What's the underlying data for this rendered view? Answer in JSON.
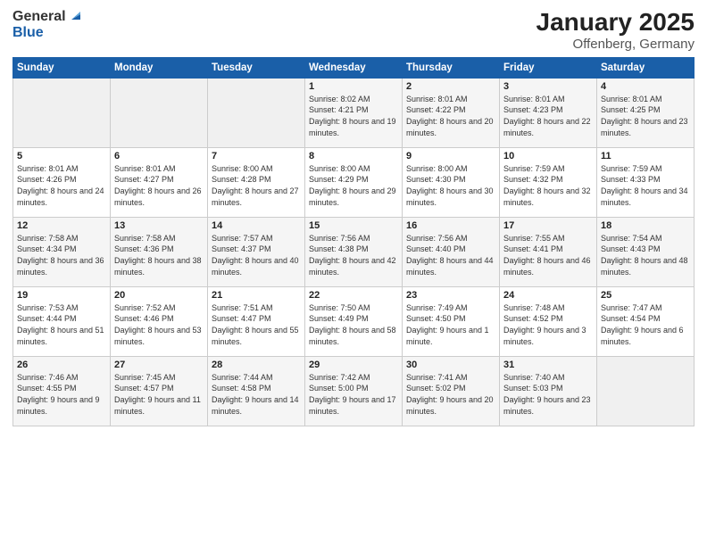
{
  "logo": {
    "general": "General",
    "blue": "Blue"
  },
  "title": "January 2025",
  "subtitle": "Offenberg, Germany",
  "weekdays": [
    "Sunday",
    "Monday",
    "Tuesday",
    "Wednesday",
    "Thursday",
    "Friday",
    "Saturday"
  ],
  "weeks": [
    [
      {
        "day": "",
        "sunrise": "",
        "sunset": "",
        "daylight": ""
      },
      {
        "day": "",
        "sunrise": "",
        "sunset": "",
        "daylight": ""
      },
      {
        "day": "",
        "sunrise": "",
        "sunset": "",
        "daylight": ""
      },
      {
        "day": "1",
        "sunrise": "Sunrise: 8:02 AM",
        "sunset": "Sunset: 4:21 PM",
        "daylight": "Daylight: 8 hours and 19 minutes."
      },
      {
        "day": "2",
        "sunrise": "Sunrise: 8:01 AM",
        "sunset": "Sunset: 4:22 PM",
        "daylight": "Daylight: 8 hours and 20 minutes."
      },
      {
        "day": "3",
        "sunrise": "Sunrise: 8:01 AM",
        "sunset": "Sunset: 4:23 PM",
        "daylight": "Daylight: 8 hours and 22 minutes."
      },
      {
        "day": "4",
        "sunrise": "Sunrise: 8:01 AM",
        "sunset": "Sunset: 4:25 PM",
        "daylight": "Daylight: 8 hours and 23 minutes."
      }
    ],
    [
      {
        "day": "5",
        "sunrise": "Sunrise: 8:01 AM",
        "sunset": "Sunset: 4:26 PM",
        "daylight": "Daylight: 8 hours and 24 minutes."
      },
      {
        "day": "6",
        "sunrise": "Sunrise: 8:01 AM",
        "sunset": "Sunset: 4:27 PM",
        "daylight": "Daylight: 8 hours and 26 minutes."
      },
      {
        "day": "7",
        "sunrise": "Sunrise: 8:00 AM",
        "sunset": "Sunset: 4:28 PM",
        "daylight": "Daylight: 8 hours and 27 minutes."
      },
      {
        "day": "8",
        "sunrise": "Sunrise: 8:00 AM",
        "sunset": "Sunset: 4:29 PM",
        "daylight": "Daylight: 8 hours and 29 minutes."
      },
      {
        "day": "9",
        "sunrise": "Sunrise: 8:00 AM",
        "sunset": "Sunset: 4:30 PM",
        "daylight": "Daylight: 8 hours and 30 minutes."
      },
      {
        "day": "10",
        "sunrise": "Sunrise: 7:59 AM",
        "sunset": "Sunset: 4:32 PM",
        "daylight": "Daylight: 8 hours and 32 minutes."
      },
      {
        "day": "11",
        "sunrise": "Sunrise: 7:59 AM",
        "sunset": "Sunset: 4:33 PM",
        "daylight": "Daylight: 8 hours and 34 minutes."
      }
    ],
    [
      {
        "day": "12",
        "sunrise": "Sunrise: 7:58 AM",
        "sunset": "Sunset: 4:34 PM",
        "daylight": "Daylight: 8 hours and 36 minutes."
      },
      {
        "day": "13",
        "sunrise": "Sunrise: 7:58 AM",
        "sunset": "Sunset: 4:36 PM",
        "daylight": "Daylight: 8 hours and 38 minutes."
      },
      {
        "day": "14",
        "sunrise": "Sunrise: 7:57 AM",
        "sunset": "Sunset: 4:37 PM",
        "daylight": "Daylight: 8 hours and 40 minutes."
      },
      {
        "day": "15",
        "sunrise": "Sunrise: 7:56 AM",
        "sunset": "Sunset: 4:38 PM",
        "daylight": "Daylight: 8 hours and 42 minutes."
      },
      {
        "day": "16",
        "sunrise": "Sunrise: 7:56 AM",
        "sunset": "Sunset: 4:40 PM",
        "daylight": "Daylight: 8 hours and 44 minutes."
      },
      {
        "day": "17",
        "sunrise": "Sunrise: 7:55 AM",
        "sunset": "Sunset: 4:41 PM",
        "daylight": "Daylight: 8 hours and 46 minutes."
      },
      {
        "day": "18",
        "sunrise": "Sunrise: 7:54 AM",
        "sunset": "Sunset: 4:43 PM",
        "daylight": "Daylight: 8 hours and 48 minutes."
      }
    ],
    [
      {
        "day": "19",
        "sunrise": "Sunrise: 7:53 AM",
        "sunset": "Sunset: 4:44 PM",
        "daylight": "Daylight: 8 hours and 51 minutes."
      },
      {
        "day": "20",
        "sunrise": "Sunrise: 7:52 AM",
        "sunset": "Sunset: 4:46 PM",
        "daylight": "Daylight: 8 hours and 53 minutes."
      },
      {
        "day": "21",
        "sunrise": "Sunrise: 7:51 AM",
        "sunset": "Sunset: 4:47 PM",
        "daylight": "Daylight: 8 hours and 55 minutes."
      },
      {
        "day": "22",
        "sunrise": "Sunrise: 7:50 AM",
        "sunset": "Sunset: 4:49 PM",
        "daylight": "Daylight: 8 hours and 58 minutes."
      },
      {
        "day": "23",
        "sunrise": "Sunrise: 7:49 AM",
        "sunset": "Sunset: 4:50 PM",
        "daylight": "Daylight: 9 hours and 1 minute."
      },
      {
        "day": "24",
        "sunrise": "Sunrise: 7:48 AM",
        "sunset": "Sunset: 4:52 PM",
        "daylight": "Daylight: 9 hours and 3 minutes."
      },
      {
        "day": "25",
        "sunrise": "Sunrise: 7:47 AM",
        "sunset": "Sunset: 4:54 PM",
        "daylight": "Daylight: 9 hours and 6 minutes."
      }
    ],
    [
      {
        "day": "26",
        "sunrise": "Sunrise: 7:46 AM",
        "sunset": "Sunset: 4:55 PM",
        "daylight": "Daylight: 9 hours and 9 minutes."
      },
      {
        "day": "27",
        "sunrise": "Sunrise: 7:45 AM",
        "sunset": "Sunset: 4:57 PM",
        "daylight": "Daylight: 9 hours and 11 minutes."
      },
      {
        "day": "28",
        "sunrise": "Sunrise: 7:44 AM",
        "sunset": "Sunset: 4:58 PM",
        "daylight": "Daylight: 9 hours and 14 minutes."
      },
      {
        "day": "29",
        "sunrise": "Sunrise: 7:42 AM",
        "sunset": "Sunset: 5:00 PM",
        "daylight": "Daylight: 9 hours and 17 minutes."
      },
      {
        "day": "30",
        "sunrise": "Sunrise: 7:41 AM",
        "sunset": "Sunset: 5:02 PM",
        "daylight": "Daylight: 9 hours and 20 minutes."
      },
      {
        "day": "31",
        "sunrise": "Sunrise: 7:40 AM",
        "sunset": "Sunset: 5:03 PM",
        "daylight": "Daylight: 9 hours and 23 minutes."
      },
      {
        "day": "",
        "sunrise": "",
        "sunset": "",
        "daylight": ""
      }
    ]
  ]
}
